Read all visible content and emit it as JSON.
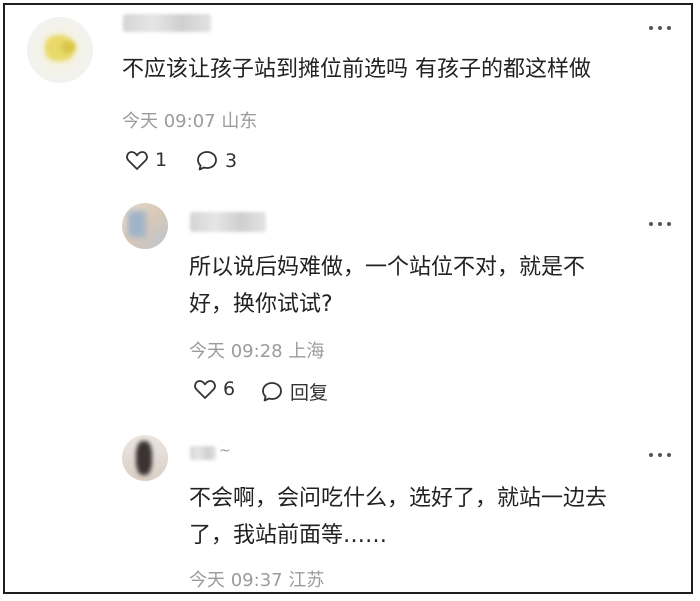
{
  "comments": [
    {
      "text": "不应该让孩子站到摊位前选吗 有孩子的都这样做",
      "meta": "今天 09:07 山东",
      "likes": "1",
      "replies": "3"
    },
    {
      "text_line1": "所以说后妈难做，一个站位不对，就是不",
      "text_line2": "好，换你试试?",
      "meta": "今天 09:28 上海",
      "likes": "6",
      "reply_label": "回复"
    },
    {
      "text_line1": "不会啊，会问吃什么，选好了，就站一边去",
      "text_line2": "了，我站前面等……",
      "meta": "今天 09:37 江苏"
    }
  ],
  "icons": {
    "like": "heart-icon",
    "comment": "speech-bubble-icon",
    "more": "more-dots-icon"
  }
}
